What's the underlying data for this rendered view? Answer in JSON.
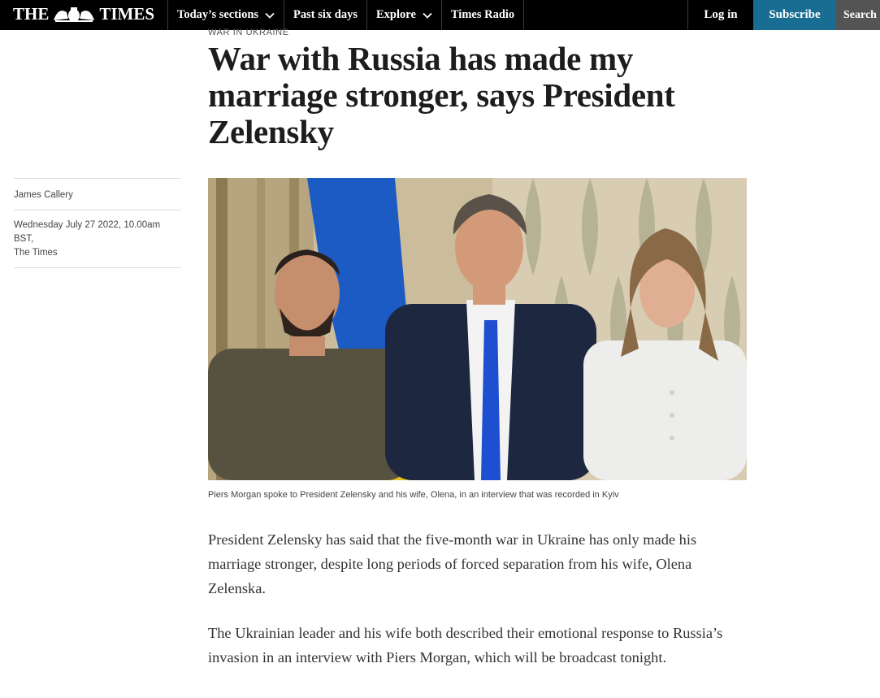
{
  "header": {
    "logo_left": "THE",
    "logo_right": "TIMES",
    "crest_icon": "royal-crest-icon",
    "nav": [
      {
        "label": "Today’s sections",
        "has_dropdown": true
      },
      {
        "label": "Past six days",
        "has_dropdown": false
      },
      {
        "label": "Explore",
        "has_dropdown": true
      },
      {
        "label": "Times Radio",
        "has_dropdown": false
      }
    ],
    "login_label": "Log in",
    "subscribe_label": "Subscribe",
    "search_label": "Search",
    "colors": {
      "bar": "#000000",
      "subscribe": "#1a6d92",
      "search": "#545454",
      "text": "#ffffff"
    }
  },
  "article": {
    "kicker": "WAR IN UKRAINE",
    "headline": "War with Russia has made my marriage stronger, says President Zelensky",
    "author": "James Callery",
    "date": "Wednesday July 27 2022, 10.00am BST,",
    "source": "The Times",
    "caption": "Piers Morgan spoke to President Zelensky and his wife, Olena, in an interview that was recorded in Kyiv",
    "paragraphs": [
      "President Zelensky has said that the five-month war in Ukraine has only made his marriage stronger, despite long periods of forced separation from his wife, Olena Zelenska.",
      "The Ukrainian leader and his wife both described their emotional response to Russia’s invasion in an interview with Piers Morgan, which will be broadcast tonight."
    ]
  }
}
